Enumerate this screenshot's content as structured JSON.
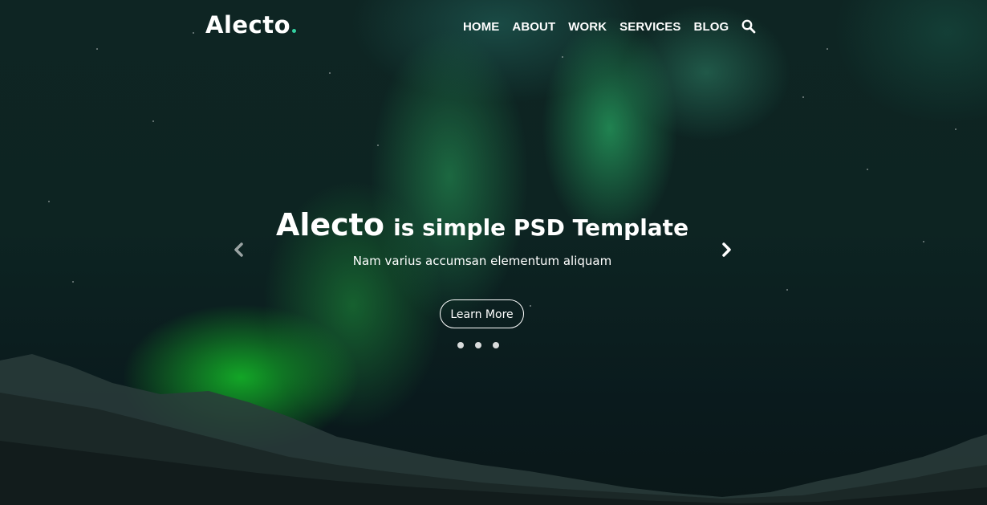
{
  "brand": {
    "name": "Alecto",
    "accent_color": "#33d1a0"
  },
  "nav": {
    "items": [
      {
        "label": "HOME"
      },
      {
        "label": "ABOUT"
      },
      {
        "label": "WORK"
      },
      {
        "label": "SERVICES"
      },
      {
        "label": "BLOG"
      }
    ],
    "search_icon": "search-icon"
  },
  "hero": {
    "headline_brand": "Alecto",
    "headline_rest": "is simple PSD Template",
    "subtitle": "Nam varius accumsan elementum aliquam",
    "cta_label": "Learn More",
    "prev_icon": "chevron-left-icon",
    "next_icon": "chevron-right-icon",
    "slide_count": 3
  }
}
